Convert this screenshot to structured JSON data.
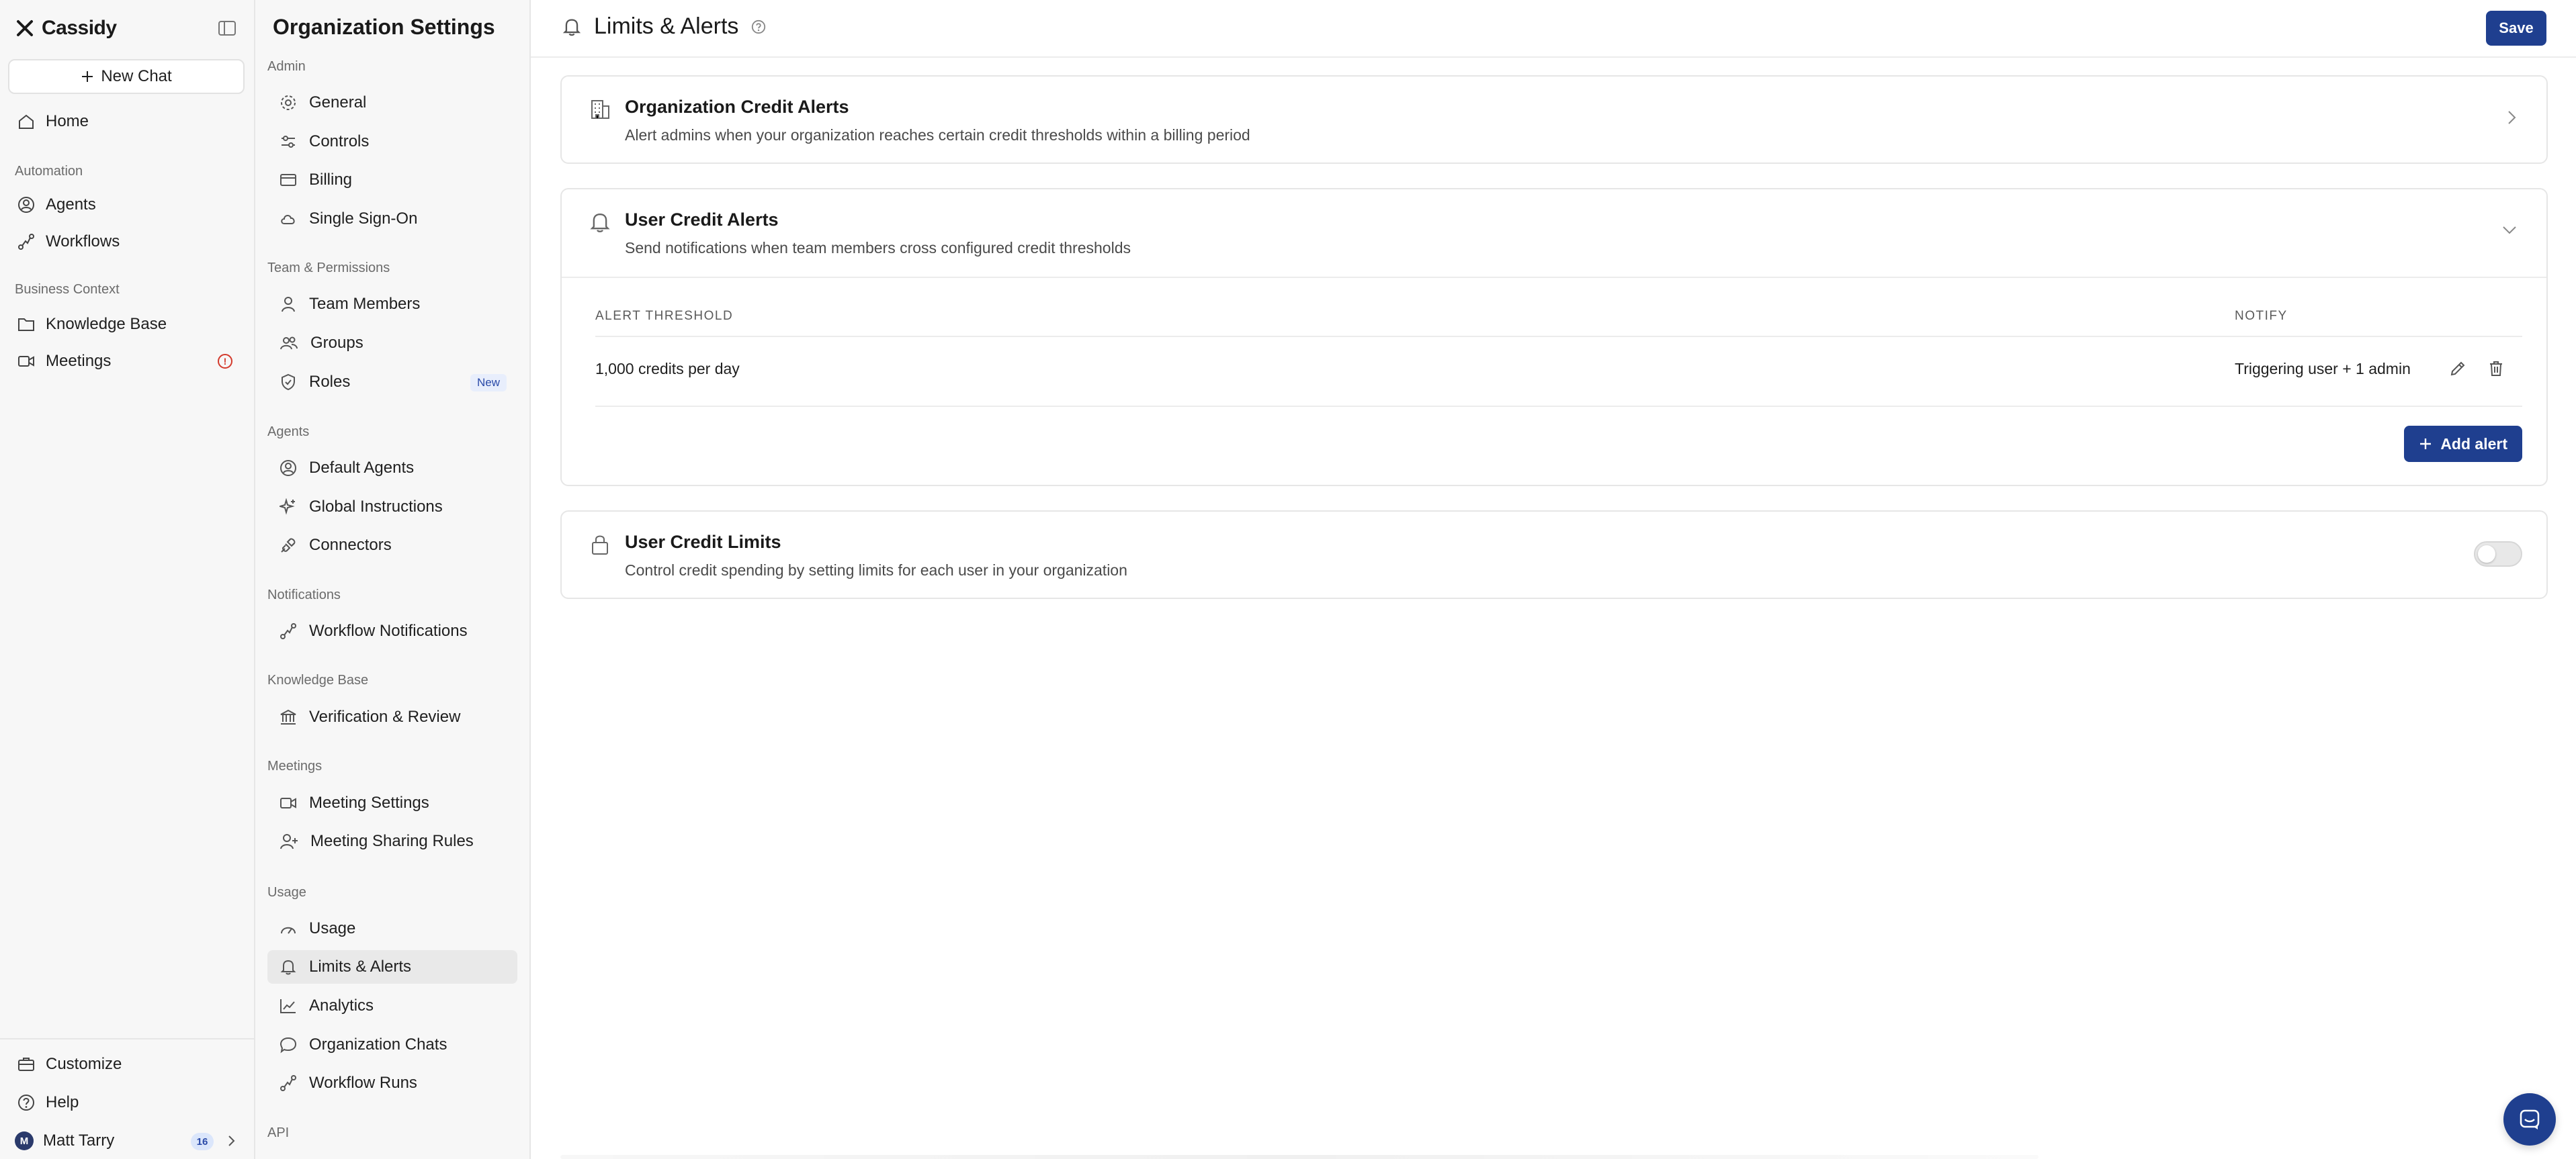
{
  "app": {
    "brand": "Cassidy"
  },
  "leftnav": {
    "new_chat": "New Chat",
    "home": "Home",
    "automation_section": "Automation",
    "agents": "Agents",
    "workflows": "Workflows",
    "business_section": "Business Context",
    "knowledge_base": "Knowledge Base",
    "meetings": "Meetings",
    "meetings_alert": "!",
    "customize": "Customize",
    "help": "Help",
    "user_name": "Matt Tarry",
    "user_initial": "M",
    "user_count": "16"
  },
  "settings": {
    "title": "Organization Settings",
    "sections": {
      "admin": "Admin",
      "team": "Team & Permissions",
      "agents": "Agents",
      "notifications": "Notifications",
      "knowledge": "Knowledge Base",
      "meetings": "Meetings",
      "usage": "Usage",
      "api": "API"
    },
    "items": {
      "general": "General",
      "controls": "Controls",
      "billing": "Billing",
      "sso": "Single Sign-On",
      "team_members": "Team Members",
      "groups": "Groups",
      "roles": "Roles",
      "roles_badge": "New",
      "default_agents": "Default Agents",
      "global_instructions": "Global Instructions",
      "connectors": "Connectors",
      "workflow_notifications": "Workflow Notifications",
      "verification_review": "Verification & Review",
      "meeting_settings": "Meeting Settings",
      "meeting_sharing": "Meeting Sharing Rules",
      "usage": "Usage",
      "limits_alerts": "Limits & Alerts",
      "analytics": "Analytics",
      "org_chats": "Organization Chats",
      "workflow_runs": "Workflow Runs"
    }
  },
  "main": {
    "title": "Limits & Alerts",
    "save": "Save",
    "org_alerts": {
      "title": "Organization Credit Alerts",
      "desc": "Alert admins when your organization reaches certain credit thresholds within a billing period"
    },
    "user_alerts": {
      "title": "User Credit Alerts",
      "desc": "Send notifications when team members cross configured credit thresholds",
      "col_threshold": "ALERT THRESHOLD",
      "col_notify": "NOTIFY",
      "rows": [
        {
          "threshold": "1,000 credits per day",
          "notify": "Triggering user + 1 admin"
        }
      ],
      "add_alert": "Add alert"
    },
    "user_limits": {
      "title": "User Credit Limits",
      "desc": "Control credit spending by setting limits for each user in your organization",
      "enabled": false
    }
  },
  "colors": {
    "accent": "#1f3f8f",
    "danger": "#d33a2c",
    "badge_bg": "#e8eefc"
  }
}
